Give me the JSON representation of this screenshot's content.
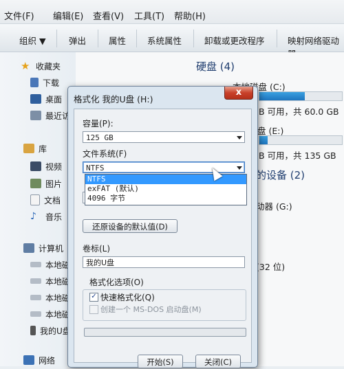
{
  "menu": [
    "文件(F)",
    "编辑(E)",
    "查看(V)",
    "工具(T)",
    "帮助(H)"
  ],
  "toolbar": [
    "组织 ▼",
    "弹出",
    "属性",
    "系统属性",
    "卸载或更改程序",
    "映射网络驱动器"
  ],
  "sidebar": {
    "favorites": "收藏夹",
    "fav_items": [
      "下载",
      "桌面",
      "最近访"
    ],
    "libraries": "库",
    "lib_items": [
      "视频",
      "图片",
      "文档",
      "音乐"
    ],
    "computer": "计算机",
    "drives": [
      "本地磁",
      "本地磁",
      "本地磁",
      "本地磁",
      "我的U盘"
    ],
    "network": "网络"
  },
  "content": {
    "hdd_title": "硬盘 (4)",
    "disk_c_label": "本地磁盘 (C:)",
    "disk_c_free": "B 可用，共 60.0 GB",
    "disk_e_label": "盘 (E:)",
    "disk_e_free": "B 可用，共 135 GB",
    "removable_title": "的设备 (2)",
    "drive_g": "动器 (G:)",
    "other_count": "(32 位)",
    "disk_c_fill": 0.55,
    "disk_e_fill": 0.1
  },
  "dialog": {
    "title": "格式化 我的U盘 (H:)",
    "close": "x",
    "capacity_label": "容量(P):",
    "capacity_value": "125 GB",
    "fs_label": "文件系统(F)",
    "fs_value": "NTFS",
    "fs_options": [
      "NTFS",
      "exFAT (默认)",
      "4096 字节"
    ],
    "restore_button": "还原设备的默认值(D)",
    "volume_label": "卷标(L)",
    "volume_value": "我的U盘",
    "format_options": "格式化选项(O)",
    "quick_format": "快速格式化(Q)",
    "quick_format_checked": true,
    "msdos": "创建一个 MS-DOS 启动盘(M)",
    "start_button": "开始(S)",
    "close_button": "关闭(C)",
    "progress": 0
  }
}
